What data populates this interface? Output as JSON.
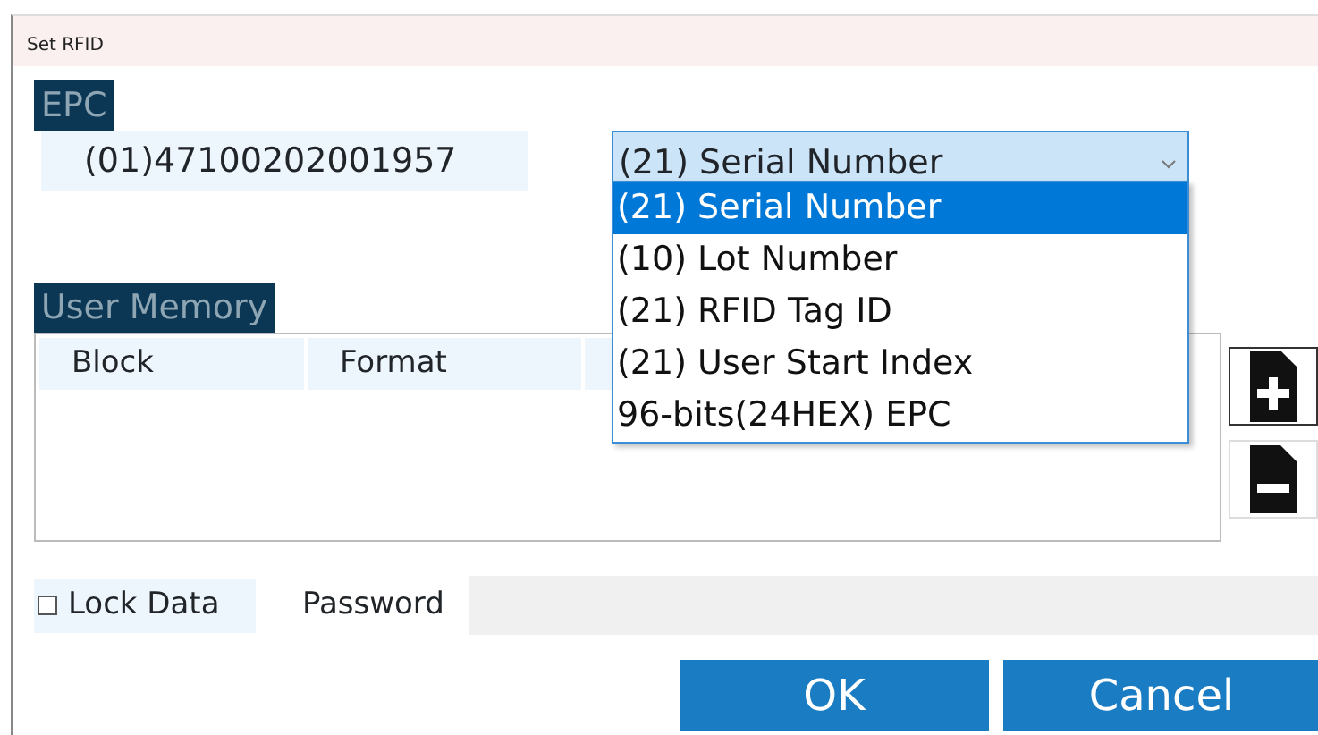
{
  "window": {
    "title": "Set RFID"
  },
  "epc": {
    "label": "EPC",
    "value": "(01)47100202001957"
  },
  "identifier_select": {
    "value": "(21) Serial Number",
    "expanded": true,
    "options": [
      {
        "label": "(21) Serial Number",
        "selected": true
      },
      {
        "label": "(10) Lot Number",
        "selected": false
      },
      {
        "label": "(21) RFID Tag ID",
        "selected": false
      },
      {
        "label": "(21) User Start Index",
        "selected": false
      },
      {
        "label": "96-bits(24HEX) EPC",
        "selected": false
      }
    ]
  },
  "user_memory": {
    "label": "User Memory",
    "columns": [
      "Block",
      "Format"
    ]
  },
  "lock_data": {
    "label": "Lock Data",
    "checked": false
  },
  "password": {
    "label": "Password"
  },
  "buttons": [
    "OK",
    "Cancel"
  ]
}
